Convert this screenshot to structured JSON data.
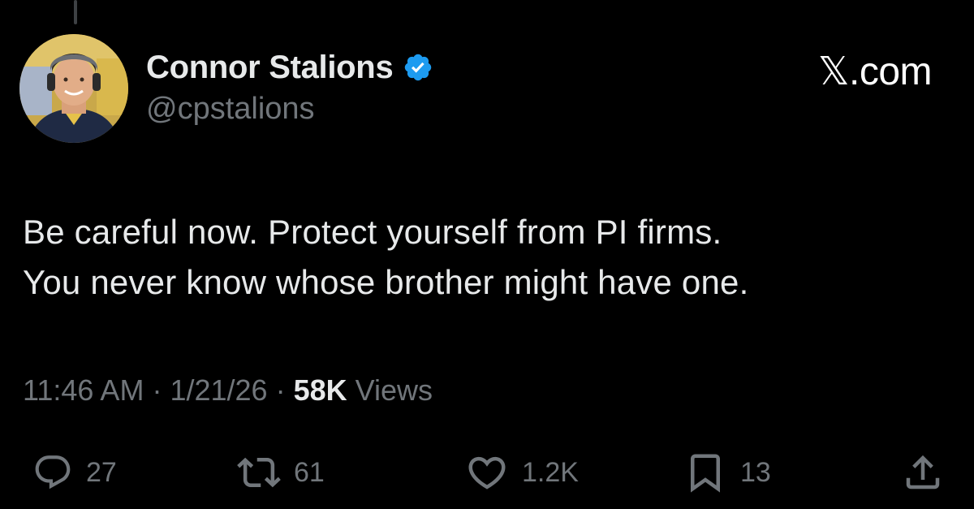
{
  "author": {
    "display_name": "Connor Stalions",
    "handle": "@cpstalions",
    "verified": true,
    "verified_icon": "verified-badge-icon",
    "verified_color": "#1d9bf0"
  },
  "brand": {
    "label": "𝕏.com"
  },
  "tweet": {
    "lines": [
      "Be careful now. Protect yourself from PI firms.",
      "You never know whose brother might have one."
    ]
  },
  "meta": {
    "time": "11:46 AM",
    "separator": "·",
    "date": "1/21/26",
    "views_count": "58K",
    "views_label": "Views"
  },
  "actions": {
    "reply": {
      "icon": "reply-icon",
      "count": "27"
    },
    "repost": {
      "icon": "repost-icon",
      "count": "61"
    },
    "like": {
      "icon": "heart-icon",
      "count": "1.2K"
    },
    "bookmark": {
      "icon": "bookmark-icon",
      "count": "13"
    },
    "share": {
      "icon": "share-icon"
    }
  },
  "colors": {
    "background": "#000000",
    "text_primary": "#e7e9ea",
    "text_secondary": "#71767b"
  }
}
